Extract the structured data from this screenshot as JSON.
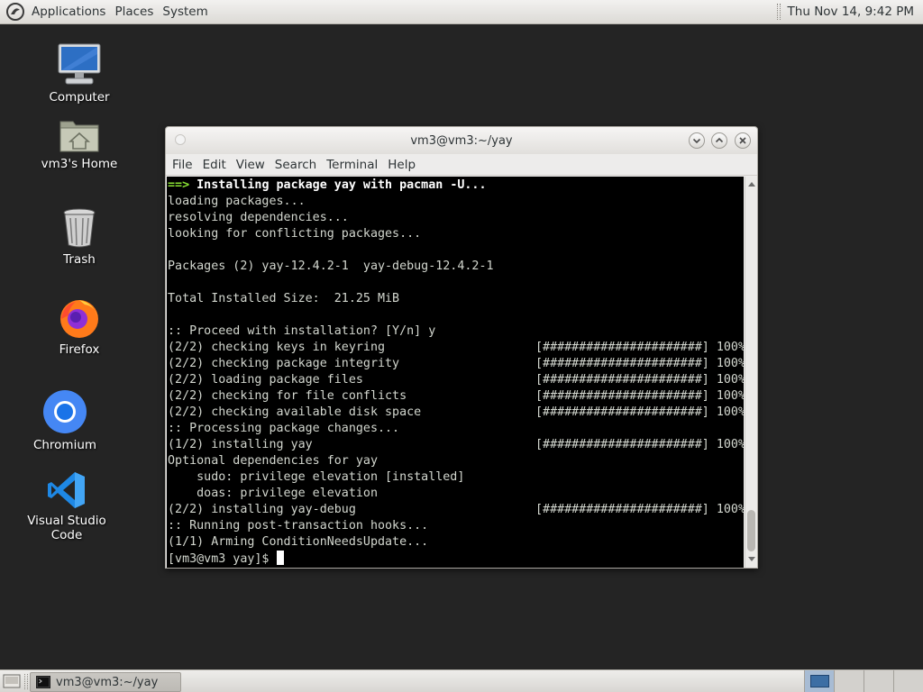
{
  "top_panel": {
    "menus": [
      "Applications",
      "Places",
      "System"
    ],
    "clock": "Thu Nov 14,  9:42 PM"
  },
  "desktop_icons": [
    {
      "label": "Computer",
      "icon": "computer-icon"
    },
    {
      "label": "vm3's Home",
      "icon": "home-folder-icon"
    },
    {
      "label": "Trash",
      "icon": "trash-icon"
    },
    {
      "label": "Firefox",
      "icon": "firefox-icon"
    },
    {
      "label": "Chromium",
      "icon": "chromium-icon"
    },
    {
      "label": "Visual Studio Code",
      "icon": "vscode-icon"
    }
  ],
  "terminal": {
    "title": "vm3@vm3:~/yay",
    "menus": [
      "File",
      "Edit",
      "View",
      "Search",
      "Terminal",
      "Help"
    ],
    "lines": [
      {
        "prefix": "==>",
        "text": " Installing package yay with pacman -U...",
        "style": "bold"
      },
      {
        "text": "loading packages..."
      },
      {
        "text": "resolving dependencies..."
      },
      {
        "text": "looking for conflicting packages..."
      },
      {
        "text": ""
      },
      {
        "text": "Packages (2) yay-12.4.2-1  yay-debug-12.4.2-1"
      },
      {
        "text": ""
      },
      {
        "text": "Total Installed Size:  21.25 MiB"
      },
      {
        "text": ""
      },
      {
        "text": ":: Proceed with installation? [Y/n] y"
      },
      {
        "text": "(2/2) checking keys in keyring",
        "progress": "[######################] 100%"
      },
      {
        "text": "(2/2) checking package integrity",
        "progress": "[######################] 100%"
      },
      {
        "text": "(2/2) loading package files",
        "progress": "[######################] 100%"
      },
      {
        "text": "(2/2) checking for file conflicts",
        "progress": "[######################] 100%"
      },
      {
        "text": "(2/2) checking available disk space",
        "progress": "[######################] 100%"
      },
      {
        "text": ":: Processing package changes..."
      },
      {
        "text": "(1/2) installing yay",
        "progress": "[######################] 100%"
      },
      {
        "text": "Optional dependencies for yay"
      },
      {
        "text": "    sudo: privilege elevation [installed]"
      },
      {
        "text": "    doas: privilege elevation"
      },
      {
        "text": "(2/2) installing yay-debug",
        "progress": "[######################] 100%"
      },
      {
        "text": ":: Running post-transaction hooks..."
      },
      {
        "text": "(1/1) Arming ConditionNeedsUpdate..."
      }
    ],
    "prompt": "[vm3@vm3 yay]$ "
  },
  "taskbar": {
    "task_label": "vm3@vm3:~/yay",
    "workspace_count": 4
  },
  "colors": {
    "desktop_bg": "#242424",
    "terminal_bg": "#000000",
    "terminal_fg": "#d3d7cf",
    "prompt_arrow": "#8ae234"
  }
}
